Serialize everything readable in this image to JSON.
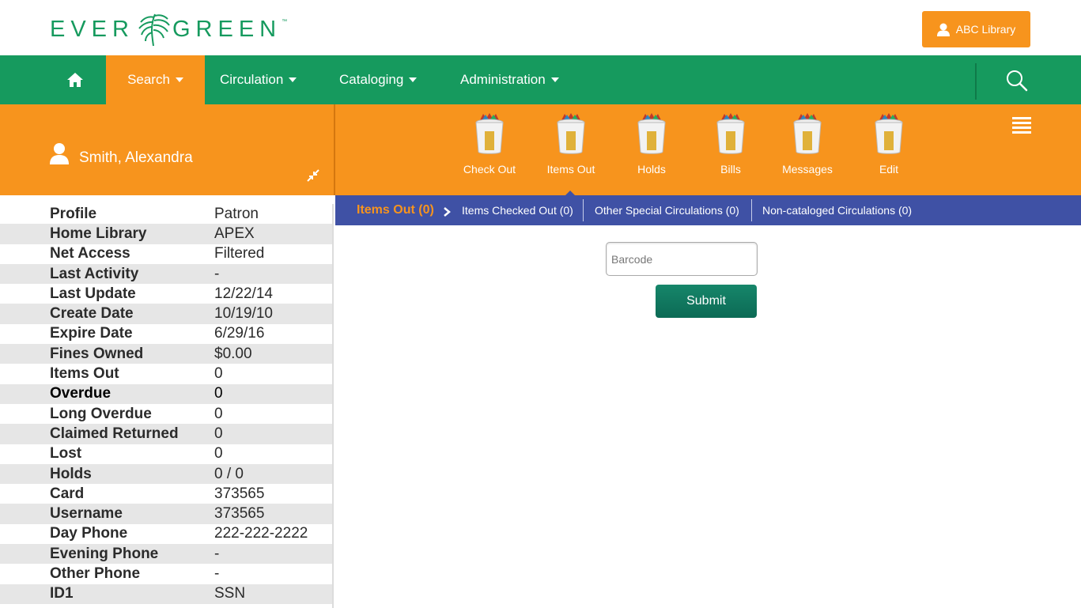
{
  "header": {
    "logo_text_left": "EVER",
    "logo_text_right": "GREEN",
    "logo_tm": "™",
    "library_button": "ABC Library",
    "user_icon": "user-icon"
  },
  "nav": {
    "home_icon": "home-icon",
    "items": [
      {
        "label": "Search",
        "active": true
      },
      {
        "label": "Circulation",
        "active": false
      },
      {
        "label": "Cataloging",
        "active": false
      },
      {
        "label": "Administration",
        "active": false
      }
    ],
    "search_icon": "search-icon"
  },
  "patron": {
    "name": "Smith, Alexandra"
  },
  "actions": [
    {
      "label": "Check Out",
      "icon": "bin-icon"
    },
    {
      "label": "Items Out",
      "icon": "bin-icon"
    },
    {
      "label": "Holds",
      "icon": "bin-icon"
    },
    {
      "label": "Bills",
      "icon": "bin-icon"
    },
    {
      "label": "Messages",
      "icon": "bin-icon"
    },
    {
      "label": "Edit",
      "icon": "bin-icon"
    }
  ],
  "subtabs": {
    "active": "Items Out (0)",
    "items": [
      "Items Checked Out (0)",
      "Other Special Circulations (0)",
      "Non-cataloged Circulations (0)"
    ]
  },
  "details": [
    {
      "key": "Profile",
      "value": "Patron"
    },
    {
      "key": "Home Library",
      "value": "APEX"
    },
    {
      "key": "Net Access",
      "value": "Filtered"
    },
    {
      "key": "Last Activity",
      "value": "-"
    },
    {
      "key": "Last Update",
      "value": "12/22/14"
    },
    {
      "key": "Create Date",
      "value": "10/19/10"
    },
    {
      "key": "Expire Date",
      "value": "6/29/16"
    },
    {
      "key": "Fines Owned",
      "value": "$0.00"
    },
    {
      "key": "Items Out",
      "value": "0"
    },
    {
      "key": "Overdue",
      "value": "0"
    },
    {
      "key": "Long Overdue",
      "value": "0"
    },
    {
      "key": "Claimed Returned",
      "value": "0"
    },
    {
      "key": "Lost",
      "value": "0"
    },
    {
      "key": "Holds",
      "value": "0 / 0"
    },
    {
      "key": "Card",
      "value": "373565"
    },
    {
      "key": "Username",
      "value": "373565"
    },
    {
      "key": "Day Phone",
      "value": "222-222-2222"
    },
    {
      "key": "Evening Phone",
      "value": "-"
    },
    {
      "key": "Other Phone",
      "value": "-"
    },
    {
      "key": "ID1",
      "value": "SSN"
    }
  ],
  "form": {
    "barcode_placeholder": "Barcode",
    "barcode_value": "",
    "submit_label": "Submit"
  },
  "colors": {
    "green": "#169a5e",
    "orange": "#f7941d",
    "indigo": "#3f51a5",
    "submit_green": "#0c6a55"
  }
}
